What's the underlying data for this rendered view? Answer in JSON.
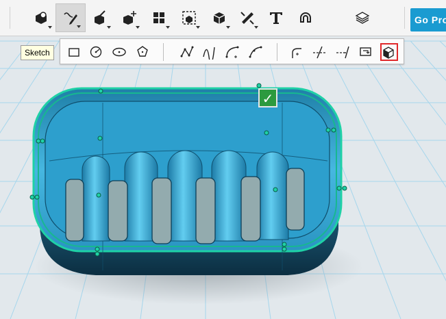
{
  "toolbar": {
    "items": [
      {
        "name": "primitives-tool-icon",
        "active": false,
        "caret": true
      },
      {
        "name": "sketch-tool-icon",
        "active": true,
        "caret": true
      },
      {
        "name": "construct-tool-icon",
        "active": false,
        "caret": true
      },
      {
        "name": "modify-tool-icon",
        "active": false,
        "caret": true
      },
      {
        "name": "pattern-tool-icon",
        "active": false,
        "caret": true
      },
      {
        "name": "grouping-tool-icon",
        "active": false,
        "caret": true
      },
      {
        "name": "combine-tool-icon",
        "active": false,
        "caret": true
      },
      {
        "name": "measure-tool-icon",
        "active": false,
        "caret": true
      },
      {
        "name": "text-tool-icon",
        "active": false,
        "caret": false
      },
      {
        "name": "snap-tool-icon",
        "active": false,
        "caret": false
      },
      {
        "name": "material-tool-icon",
        "active": false,
        "caret": false
      }
    ],
    "go_pro_label": "Go Pro"
  },
  "tooltip": {
    "text": "Sketch"
  },
  "sketch_toolbar": {
    "items": [
      "rectangle-icon",
      "circle-icon",
      "ellipse-icon",
      "polygon-icon",
      "polyline-icon",
      "spline-icon",
      "two-point-arc-icon",
      "three-point-arc-icon",
      "fillet-icon",
      "trim-icon",
      "extend-icon",
      "offset-icon",
      "project-icon"
    ],
    "highlighted": "project-icon"
  },
  "viewport": {
    "confirm_label": "✓",
    "colors": {
      "body": "#3bb0dc",
      "edge": "#16c7a0",
      "grid": "#9dd2ea",
      "background": "#e2e8ec"
    }
  }
}
